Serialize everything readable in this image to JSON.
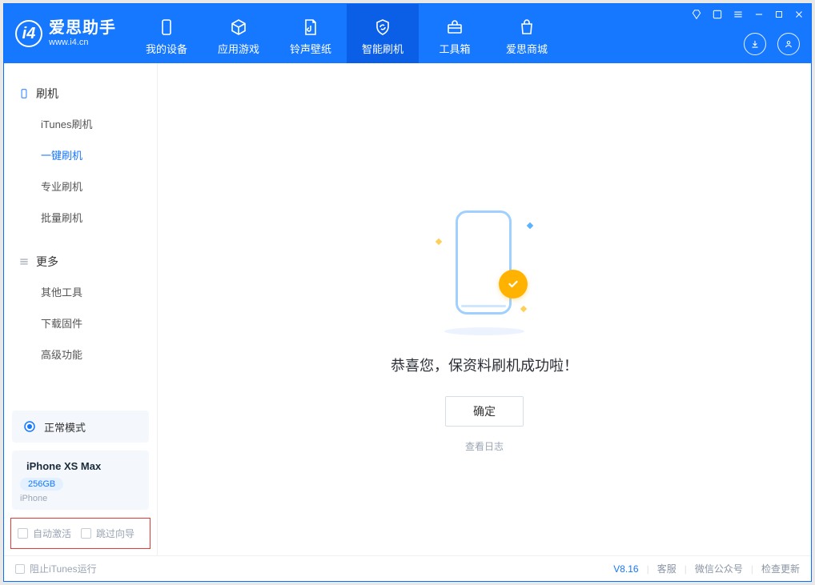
{
  "app": {
    "title": "爱思助手",
    "subtitle": "www.i4.cn"
  },
  "tabs": [
    {
      "label": "我的设备"
    },
    {
      "label": "应用游戏"
    },
    {
      "label": "铃声壁纸"
    },
    {
      "label": "智能刷机",
      "active": true
    },
    {
      "label": "工具箱"
    },
    {
      "label": "爱思商城"
    }
  ],
  "sidebar": {
    "section1": {
      "title": "刷机",
      "items": [
        "iTunes刷机",
        "一键刷机",
        "专业刷机",
        "批量刷机"
      ],
      "activeIndex": 1
    },
    "section2": {
      "title": "更多",
      "items": [
        "其他工具",
        "下载固件",
        "高级功能"
      ]
    },
    "mode_card": {
      "label": "正常模式"
    },
    "device_card": {
      "name": "iPhone XS Max",
      "capacity": "256GB",
      "sub": "iPhone"
    },
    "highlight_checks": {
      "auto_activate": "自动激活",
      "skip_guide": "跳过向导"
    }
  },
  "main": {
    "message": "恭喜您，保资料刷机成功啦！",
    "ok_button": "确定",
    "view_log_link": "查看日志"
  },
  "footer": {
    "block_itunes": "阻止iTunes运行",
    "version": "V8.16",
    "links": [
      "客服",
      "微信公众号",
      "检查更新"
    ]
  }
}
